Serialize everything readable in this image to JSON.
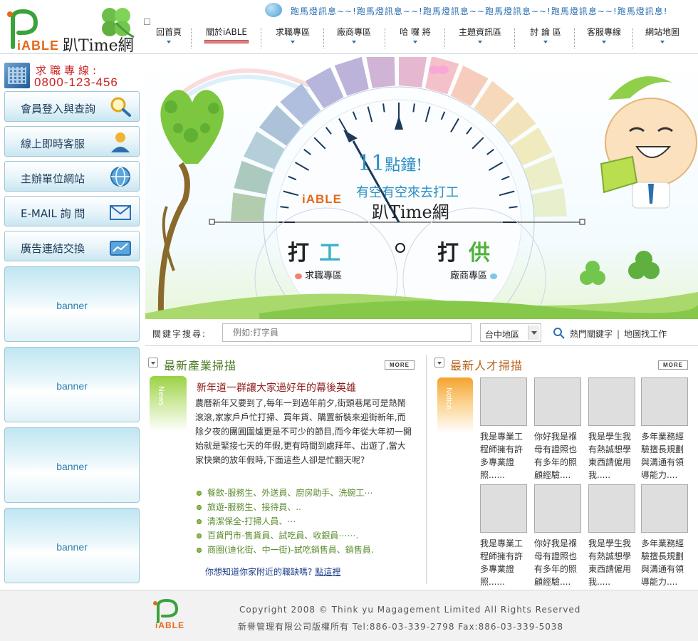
{
  "header": {
    "logo_text": "iABLE",
    "site_name": "趴Time網",
    "marquee": "跑馬燈訊息~~!跑馬燈訊息~~!跑馬燈訊息~~跑馬燈訊息~~!跑馬燈訊息~~!跑馬燈訊息!"
  },
  "nav": {
    "items": [
      {
        "label": "回首頁"
      },
      {
        "label": "關於iABLE"
      },
      {
        "label": "求職專區"
      },
      {
        "label": "廠商專區"
      },
      {
        "label": "哈 囉 將"
      },
      {
        "label": "主題資訊區"
      },
      {
        "label": "討 論 區"
      },
      {
        "label": "客服專線"
      },
      {
        "label": "網站地圖"
      }
    ],
    "active_index": 1
  },
  "sidebar": {
    "hotline_title": "求職專線:",
    "hotline_number": "0800-123-456",
    "buttons": [
      {
        "label": "會員登入與查詢",
        "icon": "magnifier-icon"
      },
      {
        "label": "線上即時客服",
        "icon": "support-person-icon"
      },
      {
        "label": "主辦單位網站",
        "icon": "globe-icon"
      },
      {
        "label": "E-MAIL 詢 問",
        "icon": "envelope-icon"
      },
      {
        "label": "廣告連結交換",
        "icon": "briefcase-chart-icon"
      }
    ],
    "banners": [
      "banner",
      "banner",
      "banner",
      "banner"
    ]
  },
  "hero": {
    "slogan_num": "11",
    "slogan_1": "點鐘!",
    "slogan_2": "有空有空來去打工",
    "brand_logo": "iABLE",
    "brand_name": "趴Time網",
    "work_a": "打",
    "work_b": "工",
    "provide_a": "打",
    "provide_b": "供",
    "link_job": "求職專區",
    "link_employer": "廠商專區"
  },
  "search": {
    "label": "關鍵字搜尋:",
    "placeholder": "例如:打字員",
    "region": "台中地區",
    "hot_keywords": "熱門關鍵字",
    "map_search": "地圖找工作"
  },
  "industry": {
    "title": "最新產業掃描",
    "more": "MORE",
    "tab": "News",
    "headline": "新年道一群讓大家過好年的幕後英雄",
    "body": "農曆新年又要到了,每年一到過年前夕,街頭巷尾可是熱鬧滾滾,家家戶戶忙打掃、買年貨、購置新裝來迎街新年,而除夕夜的團圓圍爐更是不可少的節目,而今年從大年初一開始就是緊接七天的年假,更有時間到處拜年、出遊了,當大家快樂的放年假時,下面這些人卻是忙翻天呢?",
    "list": [
      "餐飲-服務生、外送員、廚房助手、洗碗工⋯",
      "旅遊-服務生、接待員、..",
      "清潔保全-打掃人員、⋯",
      "百貨門市-售貨員、試吃員、收銀員⋯⋯.",
      "商圈(迪化街、中一街)-試吃銷售員、銷售員."
    ],
    "ask": "你想知道你家附近的職缺嗎?",
    "ask_link": "點這裡"
  },
  "talent": {
    "title": "最新人才掃描",
    "more": "MORE",
    "tab": "Notice",
    "cards": [
      "我是專業工程師擁有許多專業證照......",
      "你好我是褓母有證照也有多年的照顧經驗....",
      "我是學生我有熱誠想學東西請僱用我.....",
      "多年業務經驗擅長規劃與溝通有領導能力....",
      "我是專業工程師擁有許多專業證照......",
      "你好我是褓母有證照也有多年的照顧經驗....",
      "我是學生我有熱誠想學東西請僱用我.....",
      "多年業務經驗擅長規劃與溝通有領導能力...."
    ]
  },
  "footer": {
    "logo_text": "iABLE",
    "copyright": "Copyright 2008 © Think yu Magagement Limited All Rights Reserved",
    "company": "新譽管理有限公司版權所有 Tel:886-03-339-2798 Fax:886-03-339-5038"
  },
  "colors": {
    "brand_green": "#4fb33c",
    "brand_orange": "#e26a1b",
    "hotline_red": "#c8221f",
    "nav_active": "#e68181",
    "link_blue": "#2b6fb0"
  }
}
